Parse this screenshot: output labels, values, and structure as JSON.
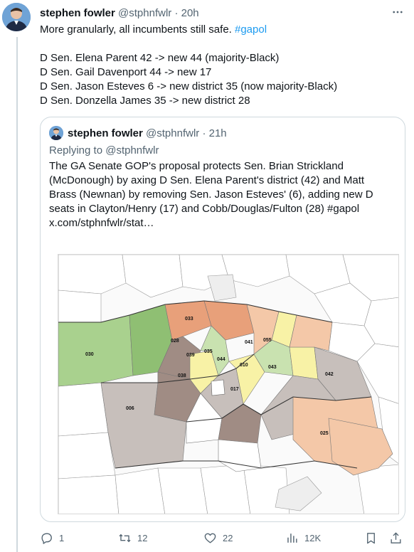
{
  "tweet": {
    "author_name": "stephen fowler",
    "author_handle": "@stphnfwlr",
    "separator": "·",
    "time": "20h",
    "text_intro": "More granularly, all incumbents still safe. ",
    "hashtag": "#gapol",
    "text_lines": "D Sen. Elena Parent 42 -> new 44 (majority-Black)\nD Sen. Gail Davenport 44 -> new 17\nD Sen. Jason Esteves 6 -> new district 35 (now majority-Black)\nD Sen. Donzella James 35 -> new district 28",
    "more_icon": "more-horizontal-icon"
  },
  "quoted": {
    "author_name": "stephen fowler",
    "author_handle": "@stphnfwlr",
    "separator": "·",
    "time": "21h",
    "reply_line": "Replying to @stphnfwlr",
    "text": "The GA Senate GOP's proposal protects Sen. Brian Strickland (McDonough) by axing D Sen. Elena Parent's district (42) and Matt Brass (Newnan) by removing Sen. Jason Esteves' (6), adding new D seats in Clayton/Henry (17) and Cobb/Douglas/Fulton (28) #gapol x.com/stphnfwlr/stat…",
    "map_labels": [
      "033",
      "028",
      "030",
      "039",
      "035",
      "038",
      "044",
      "041",
      "055",
      "043",
      "010",
      "017",
      "042",
      "006",
      "025"
    ],
    "map_colors": {
      "green": "#a9d18e",
      "dark_green": "#8fbf73",
      "brown": "#a08c84",
      "gray": "#c7bfbb",
      "peach": "#f4c8a8",
      "yellow": "#f8f2a6",
      "orange": "#e8a07a",
      "light_green": "#c9e2b0"
    }
  },
  "actions": {
    "reply": {
      "icon": "reply-icon",
      "count": "1"
    },
    "retweet": {
      "icon": "retweet-icon",
      "count": "12"
    },
    "like": {
      "icon": "heart-icon",
      "count": "22"
    },
    "views": {
      "icon": "views-icon",
      "count": "12K"
    },
    "bookmark": {
      "icon": "bookmark-icon"
    },
    "share": {
      "icon": "share-icon"
    }
  },
  "colors": {
    "accent": "#1d9bf0",
    "muted": "#536471",
    "border": "#cfd9de"
  }
}
